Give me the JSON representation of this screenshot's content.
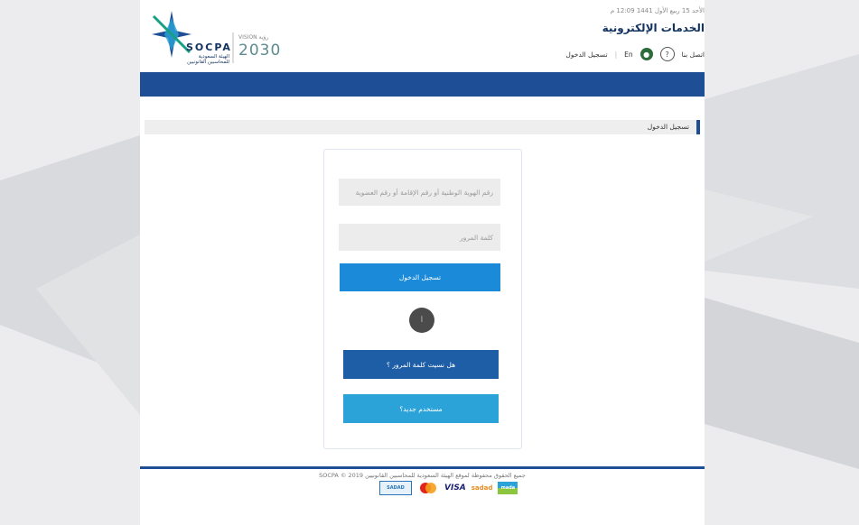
{
  "header": {
    "org_name_en": "SOCPA",
    "org_name_ar_line1": "الهيئة السعودية",
    "org_name_ar_line2": "للمحاسبين القانونيين",
    "vision_label": "VISION رؤية",
    "vision_year": "2030",
    "date_text": "الأحد 15 ربيع الأول 1441 12:09 م",
    "eservices_title": "الخدمات الإلكترونية",
    "nav": {
      "contact": "اتصل بنا",
      "lang": "En",
      "login": "تسجيل الدخول"
    }
  },
  "page_heading": "تسجيل الدخول",
  "login_form": {
    "username_placeholder": "رقم الهوية الوطنية أو رقم الإقامة أو رقم العضوية",
    "password_placeholder": "كلمة المرور",
    "login_button": "تسجيل الدخول",
    "captcha_label": "أ",
    "forgot_button": "هل نسيت كلمة المرور ؟",
    "new_user_button": "مستخدم جديد؟"
  },
  "footer": {
    "copyright": "جميع الحقوق محفوظة لموقع الهيئة السعودية للمحاسبين القانونيين SOCPA © 2019",
    "payments": [
      "SADAD",
      "mastercard",
      "VISA",
      "sadad",
      "mada"
    ]
  },
  "colors": {
    "brand_blue": "#1e4f96",
    "login_button": "#1a8ad9",
    "forgot_button": "#1e5ea7",
    "new_user_button": "#2ba2d8"
  }
}
